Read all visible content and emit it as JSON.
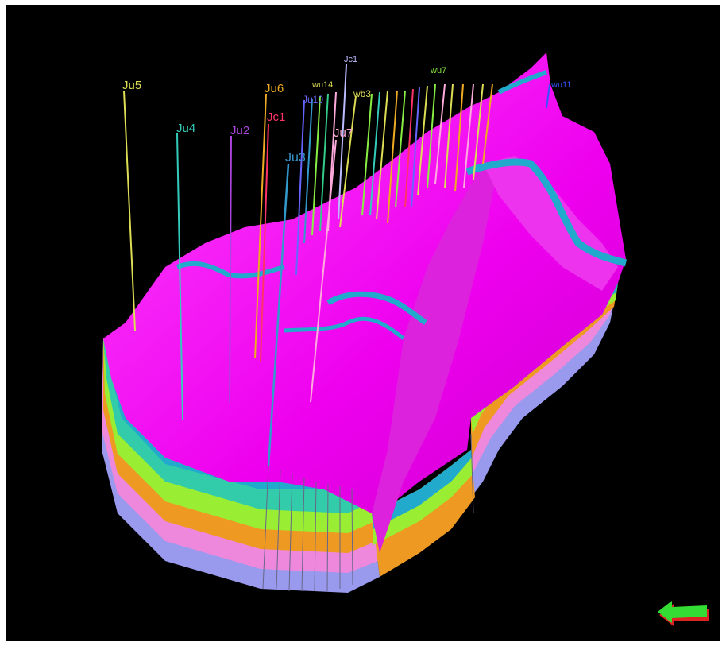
{
  "viewer": {
    "background": "#000000",
    "surface_color": "#ff00ff",
    "layer_colors": [
      "#22aacc",
      "#33ccaa",
      "#99ee33",
      "#ee9922",
      "#ee88dd",
      "#9999ee"
    ]
  },
  "wells": [
    {
      "name": "Ju5",
      "color": "#dddd55"
    },
    {
      "name": "Ju4",
      "color": "#33ccbb"
    },
    {
      "name": "Ju2",
      "color": "#aa44dd"
    },
    {
      "name": "Ju6",
      "color": "#eeaa22"
    },
    {
      "name": "Jc1",
      "color": "#ff3366"
    },
    {
      "name": "Ju3",
      "color": "#3399cc"
    },
    {
      "name": "Ju7",
      "color": "#ffaadd"
    },
    {
      "name": "Jc1",
      "color": "#bbbbff"
    },
    {
      "name": "Ju10",
      "color": "#6666ff"
    },
    {
      "name": "wu14",
      "color": "#dddd55"
    },
    {
      "name": "wb3",
      "color": "#dddd55"
    },
    {
      "name": "wu7",
      "color": "#88ee44"
    },
    {
      "name": "wu11",
      "color": "#3355ff"
    }
  ],
  "compass": {
    "icon": "compass-arrow-icon",
    "colors": [
      "#33dd33",
      "#dd2222"
    ]
  }
}
